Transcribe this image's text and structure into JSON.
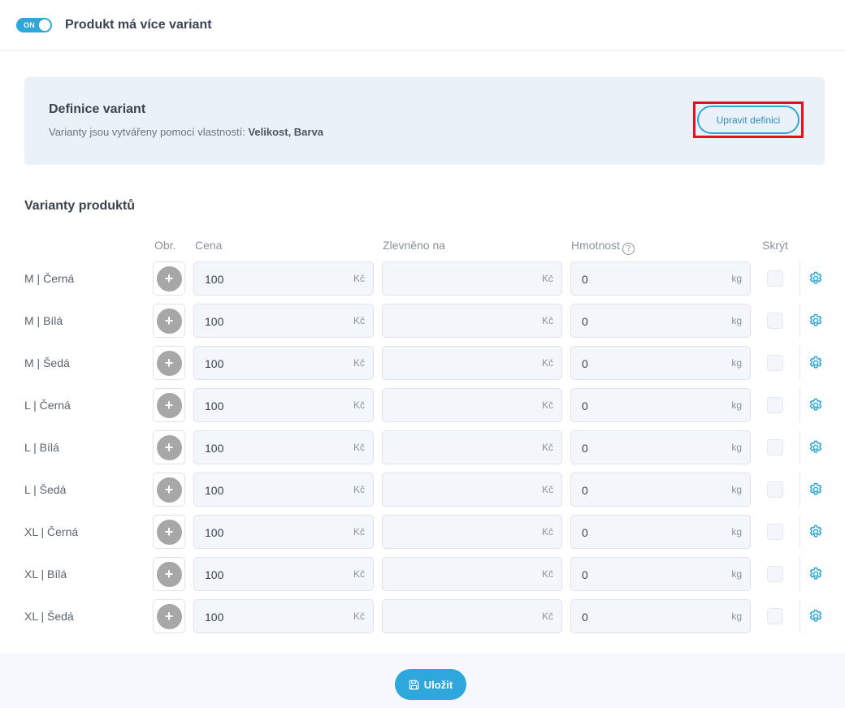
{
  "header": {
    "toggle_label": "ON",
    "title": "Produkt má více variant"
  },
  "definition": {
    "title": "Definice variant",
    "subtitle_prefix": "Varianty jsou vytvářeny pomocí vlastností:",
    "subtitle_props": "Velikost, Barva",
    "edit_button": "Upravit definici"
  },
  "variants": {
    "title": "Varianty produktů",
    "columns": {
      "image": "Obr.",
      "price": "Cena",
      "discount": "Zlevněno na",
      "weight": "Hmotnost",
      "weight_help": "?",
      "hide": "Skrýt"
    },
    "rows": [
      {
        "name": "M  |  Černá",
        "price": "100",
        "discount": "",
        "weight": "0"
      },
      {
        "name": "M  |  Bílá",
        "price": "100",
        "discount": "",
        "weight": "0"
      },
      {
        "name": "M  |  Šedá",
        "price": "100",
        "discount": "",
        "weight": "0"
      },
      {
        "name": "L  |  Černá",
        "price": "100",
        "discount": "",
        "weight": "0"
      },
      {
        "name": "L  |  Bílá",
        "price": "100",
        "discount": "",
        "weight": "0"
      },
      {
        "name": "L  |  Šedá",
        "price": "100",
        "discount": "",
        "weight": "0"
      },
      {
        "name": "XL  |  Černá",
        "price": "100",
        "discount": "",
        "weight": "0"
      },
      {
        "name": "XL  |  Bílá",
        "price": "100",
        "discount": "",
        "weight": "0"
      },
      {
        "name": "XL  |  Šedá",
        "price": "100",
        "discount": "",
        "weight": "0"
      }
    ],
    "units": {
      "currency": "Kč",
      "weight": "kg"
    },
    "add_image_glyph": "+"
  },
  "footer": {
    "save_button": "Uložit"
  },
  "colors": {
    "accent": "#2ea8dc",
    "highlight": "#e3101f",
    "card_bg": "#eaf1f9"
  }
}
